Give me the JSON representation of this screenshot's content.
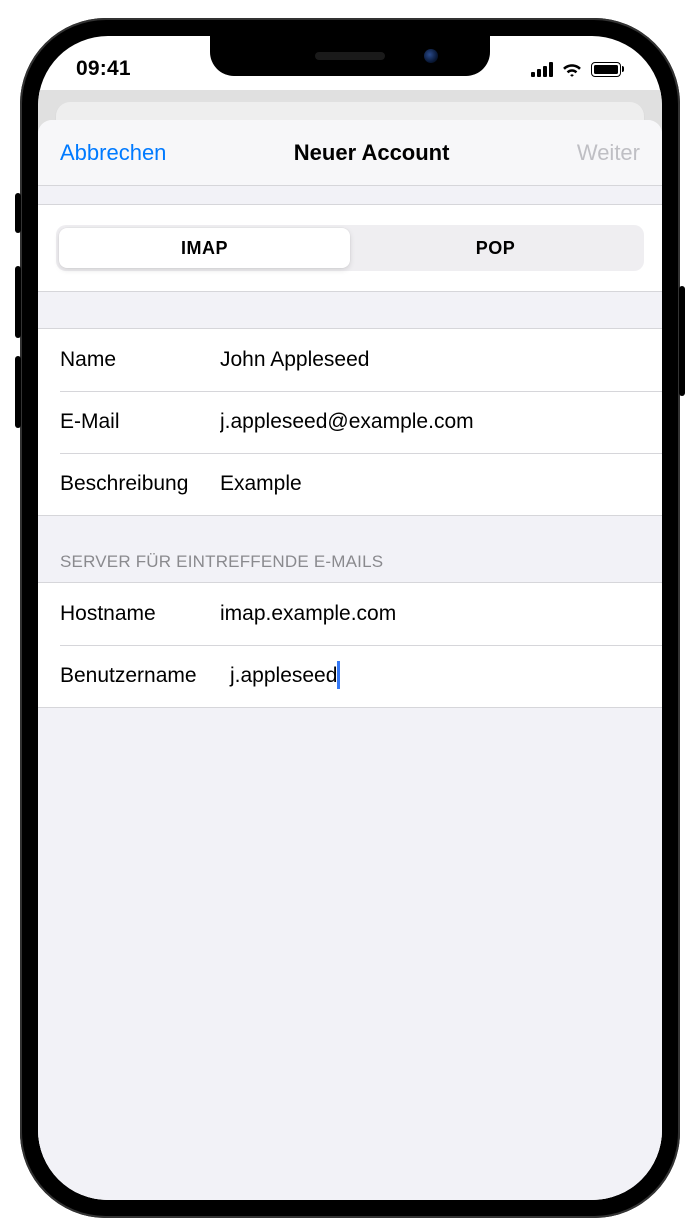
{
  "status": {
    "time": "09:41"
  },
  "nav": {
    "cancel": "Abbrechen",
    "title": "Neuer Account",
    "next": "Weiter"
  },
  "segmented": {
    "imap": "IMAP",
    "pop": "POP"
  },
  "account": {
    "name_label": "Name",
    "name_value": "John Appleseed",
    "email_label": "E-Mail",
    "email_value": "j.appleseed@example.com",
    "desc_label": "Beschreibung",
    "desc_value": "Example"
  },
  "incoming": {
    "header": "SERVER FÜR EINTREFFENDE E-MAILS",
    "host_label": "Hostname",
    "host_value": "imap.example.com",
    "user_label": "Benutzername",
    "user_value": "j.appleseed"
  }
}
